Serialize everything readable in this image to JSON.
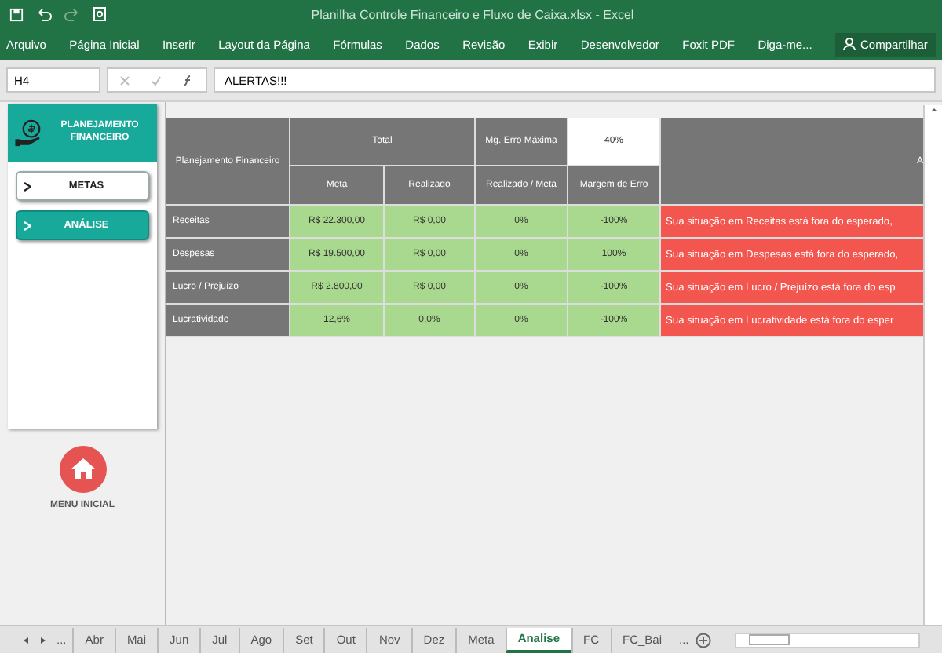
{
  "window": {
    "title": "Planilha Controle Financeiro e Fluxo de Caixa.xlsx - Excel"
  },
  "ribbon": {
    "tabs": [
      "Arquivo",
      "Página Inicial",
      "Inserir",
      "Layout da Página",
      "Fórmulas",
      "Dados",
      "Revisão",
      "Exibir",
      "Desenvolvedor",
      "Foxit PDF"
    ],
    "tell_me": "Diga-me...",
    "share": "Compartilhar"
  },
  "formula_bar": {
    "name_box": "H4",
    "formula": "ALERTAS!!!"
  },
  "sidebar": {
    "logo": "PLANEJAMENTO FINANCEIRO",
    "nav": [
      {
        "label": "METAS",
        "selected": false
      },
      {
        "label": "ANÁLISE",
        "selected": true
      }
    ],
    "home": "MENU INICIAL"
  },
  "table": {
    "corner": "Planejamento Financeiro",
    "total": "Total",
    "max_error_label": "Mg. Erro Máxima",
    "max_error_value": "40%",
    "alert_heading": "A",
    "columns": [
      "Meta",
      "Realizado",
      "Realizado / Meta",
      "Margem de Erro"
    ],
    "rows": [
      {
        "label": "Receitas",
        "cells": [
          "R$ 22.300,00",
          "R$ 0,00",
          "0%",
          "-100%"
        ],
        "alert": "Sua situação em Receitas está fora do esperado,"
      },
      {
        "label": "Despesas",
        "cells": [
          "R$ 19.500,00",
          "R$ 0,00",
          "0%",
          "100%"
        ],
        "alert": "Sua situação em Despesas está fora do esperado,"
      },
      {
        "label": "Lucro / Prejuízo",
        "cells": [
          "R$ 2.800,00",
          "R$ 0,00",
          "0%",
          "-100%"
        ],
        "alert": "Sua situação em Lucro / Prejuízo está fora do esp"
      },
      {
        "label": "Lucratividade",
        "cells": [
          "12,6%",
          "0,0%",
          "0%",
          "-100%"
        ],
        "alert": "Sua situação em Lucratividade está fora do esper"
      }
    ]
  },
  "sheet_tabs": {
    "more_left": "...",
    "tabs": [
      {
        "label": "Abr",
        "selected": false
      },
      {
        "label": "Mai",
        "selected": false
      },
      {
        "label": "Jun",
        "selected": false
      },
      {
        "label": "Jul",
        "selected": false
      },
      {
        "label": "Ago",
        "selected": false
      },
      {
        "label": "Set",
        "selected": false
      },
      {
        "label": "Out",
        "selected": false
      },
      {
        "label": "Nov",
        "selected": false
      },
      {
        "label": "Dez",
        "selected": false
      },
      {
        "label": "Meta",
        "selected": false
      },
      {
        "label": "Analise",
        "selected": true
      },
      {
        "label": "FC",
        "selected": false
      },
      {
        "label": "FC_Bai",
        "selected": false
      }
    ],
    "more_right": "..."
  }
}
